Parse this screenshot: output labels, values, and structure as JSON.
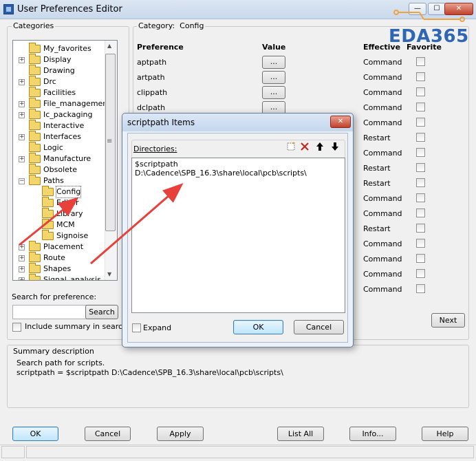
{
  "window": {
    "title": "User Preferences Editor",
    "watermark": "EDA365",
    "minimize_glyph": "—",
    "maximize_glyph": "☐",
    "close_glyph": "✕"
  },
  "categories": {
    "label": "Categories",
    "items": [
      {
        "label": "My_favorites",
        "expander": ""
      },
      {
        "label": "Display",
        "expander": "+"
      },
      {
        "label": "Drawing",
        "expander": ""
      },
      {
        "label": "Drc",
        "expander": "+"
      },
      {
        "label": "Facilities",
        "expander": ""
      },
      {
        "label": "File_management",
        "expander": "+"
      },
      {
        "label": "Ic_packaging",
        "expander": "+"
      },
      {
        "label": "Interactive",
        "expander": ""
      },
      {
        "label": "Interfaces",
        "expander": "+"
      },
      {
        "label": "Logic",
        "expander": ""
      },
      {
        "label": "Manufacture",
        "expander": "+"
      },
      {
        "label": "Obsolete",
        "expander": ""
      },
      {
        "label": "Paths",
        "expander": "−"
      },
      {
        "label": "Config",
        "expander": ""
      },
      {
        "label": "Editor",
        "expander": ""
      },
      {
        "label": "Library",
        "expander": ""
      },
      {
        "label": "MCM",
        "expander": ""
      },
      {
        "label": "Signoise",
        "expander": ""
      },
      {
        "label": "Placement",
        "expander": "+"
      },
      {
        "label": "Route",
        "expander": "+"
      },
      {
        "label": "Shapes",
        "expander": "+"
      },
      {
        "label": "Signal_analysis",
        "expander": "+"
      }
    ]
  },
  "search": {
    "label": "Search for preference:",
    "value": "",
    "button": "Search",
    "include_summary_label": "Include summary in search",
    "include_summary_checked": false
  },
  "preferences": {
    "category_label": "Category:",
    "category_value": "Config",
    "headers": {
      "preference": "Preference",
      "value": "Value",
      "effective": "Effective",
      "favorite": "Favorite"
    },
    "value_button": "...",
    "rows": [
      {
        "name": "aptpath",
        "effective": "Command"
      },
      {
        "name": "artpath",
        "effective": "Command"
      },
      {
        "name": "clippath",
        "effective": "Command"
      },
      {
        "name": "dclpath",
        "effective": "Command"
      },
      {
        "name": "",
        "effective": "Command"
      },
      {
        "name": "",
        "effective": "Restart"
      },
      {
        "name": "",
        "effective": "Command"
      },
      {
        "name": "",
        "effective": "Restart"
      },
      {
        "name": "",
        "effective": "Restart"
      },
      {
        "name": "",
        "effective": "Command"
      },
      {
        "name": "",
        "effective": "Command"
      },
      {
        "name": "",
        "effective": "Restart"
      },
      {
        "name": "",
        "effective": "Command"
      },
      {
        "name": "",
        "effective": "Command"
      },
      {
        "name": "",
        "effective": "Command"
      },
      {
        "name": "",
        "effective": "Command"
      }
    ],
    "next_button": "Next"
  },
  "summary": {
    "label": "Summary description",
    "line1": "Search path for scripts.",
    "line2": "scriptpath = $scriptpath D:\\Cadence\\SPB_16.3\\share\\local\\pcb\\scripts\\"
  },
  "buttons": {
    "ok": "OK",
    "cancel": "Cancel",
    "apply": "Apply",
    "list_all": "List All",
    "info": "Info...",
    "help": "Help"
  },
  "dialog": {
    "title": "scriptpath Items",
    "close_glyph": "✕",
    "directories_label": "Directories:",
    "entries": [
      "$scriptpath",
      "D:\\Cadence\\SPB_16.3\\share\\local\\pcb\\scripts\\"
    ],
    "expand_label": "Expand",
    "expand_checked": false,
    "ok": "OK",
    "cancel": "Cancel"
  },
  "colors": {
    "annotation_arrow": "#e8403a",
    "logo": "#2f66b3",
    "circuit": "#f2a23a"
  }
}
